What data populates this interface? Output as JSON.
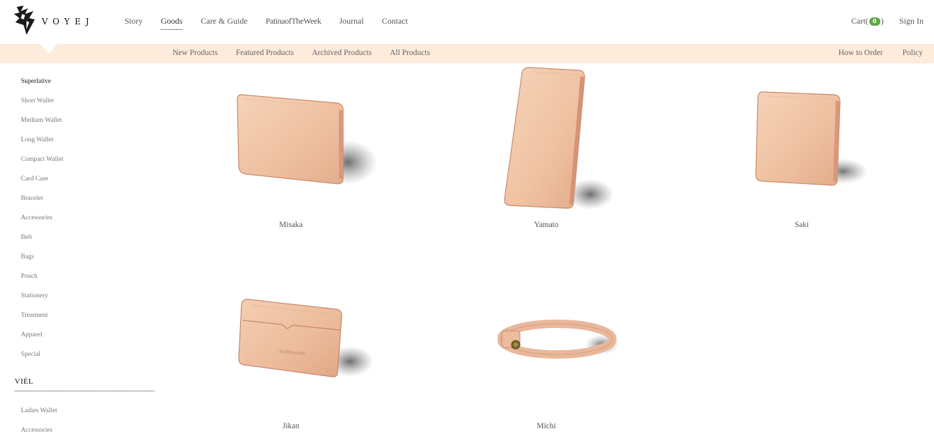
{
  "brand": {
    "name": "VOYEJ",
    "trademark": "®"
  },
  "nav": {
    "items": [
      {
        "label": "Story",
        "active": false
      },
      {
        "label": "Goods",
        "active": true
      },
      {
        "label": "Care & Guide",
        "active": false
      },
      {
        "label": "PatinaofTheWeek",
        "active": false
      },
      {
        "label": "Journal",
        "active": false
      },
      {
        "label": "Contact",
        "active": false
      }
    ],
    "cart_label": "Cart(",
    "cart_count": "0",
    "cart_close": ")",
    "signin_label": "Sign In"
  },
  "subnav": {
    "left": [
      "New Products",
      "Featured Products",
      "Archived Products",
      "All Products"
    ],
    "right": [
      "How to Order",
      "Policy"
    ]
  },
  "sidebar": {
    "items": [
      "Superlative",
      "Short Wallet",
      "Medium Wallet",
      "Long Wallet",
      "Compact Wallet",
      "Card Case",
      "Bracelet",
      "Accessories",
      "Belt",
      "Bags",
      "Pouch",
      "Stationery",
      "Treatment",
      "Apparel",
      "Special"
    ],
    "selected_index": 0,
    "heading2": "VIÉL",
    "items2": [
      "Ladies Wallet",
      "Accessories"
    ]
  },
  "products": [
    {
      "name": "Misaka",
      "icon": "bifold-wallet-image"
    },
    {
      "name": "Yamato",
      "icon": "long-wallet-image"
    },
    {
      "name": "Saki",
      "icon": "compact-wallet-image"
    },
    {
      "name": "Jikan",
      "icon": "card-case-image"
    },
    {
      "name": "Michi",
      "icon": "bracelet-image"
    }
  ],
  "colors": {
    "leather": "#f0c4a4",
    "leather_dark": "#d99f7c",
    "subnav_bg": "#fdebdb",
    "cart_badge": "#5fa84a"
  }
}
